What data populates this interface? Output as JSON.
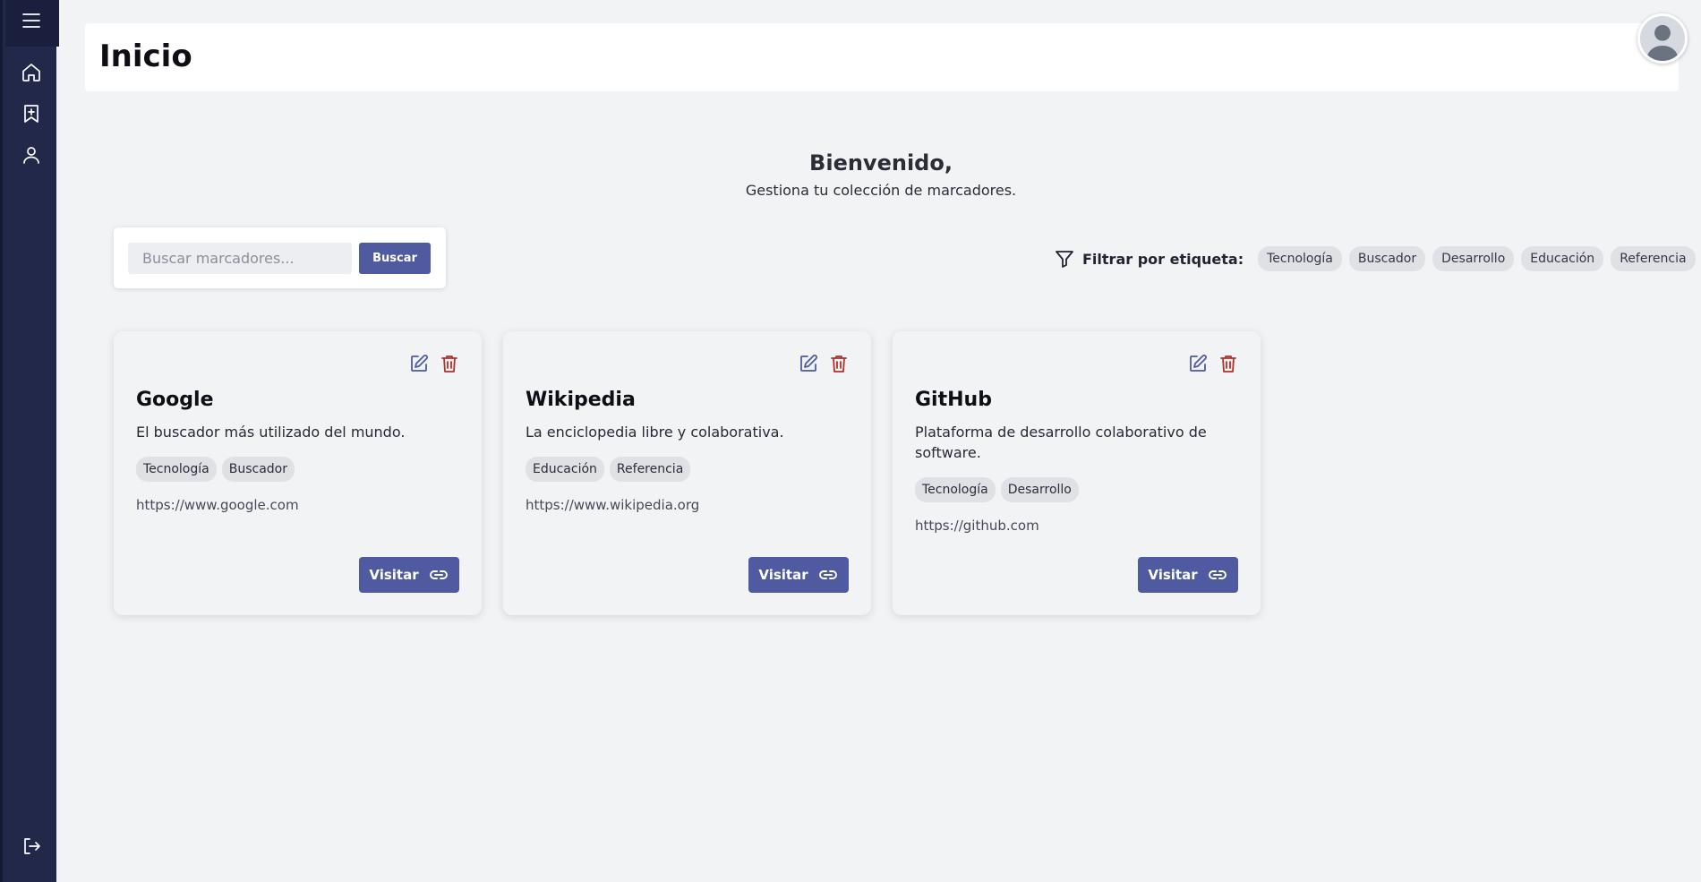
{
  "sidebar": {
    "items": [
      {
        "icon": "menu-icon"
      },
      {
        "icon": "home-icon"
      },
      {
        "icon": "bookmark-add-icon"
      },
      {
        "icon": "user-icon"
      },
      {
        "icon": "logout-icon"
      }
    ]
  },
  "header": {
    "title": "Inicio"
  },
  "welcome": {
    "title": "Bienvenido,",
    "subtitle": "Gestiona tu colección de marcadores."
  },
  "search": {
    "placeholder": "Buscar marcadores...",
    "button_label": "Buscar"
  },
  "filter": {
    "label": "Filtrar por etiqueta:",
    "tags": [
      "Tecnología",
      "Buscador",
      "Desarrollo",
      "Educación",
      "Referencia"
    ]
  },
  "bookmarks": [
    {
      "title": "Google",
      "description": "El buscador más utilizado del mundo.",
      "tags": [
        "Tecnología",
        "Buscador"
      ],
      "url": "https://www.google.com",
      "visit_label": "Visitar"
    },
    {
      "title": "Wikipedia",
      "description": "La enciclopedia libre y colaborativa.",
      "tags": [
        "Educación",
        "Referencia"
      ],
      "url": "https://www.wikipedia.org",
      "visit_label": "Visitar"
    },
    {
      "title": "GitHub",
      "description": "Plataforma de desarrollo colaborativo de software.",
      "tags": [
        "Tecnología",
        "Desarrollo"
      ],
      "url": "https://github.com",
      "visit_label": "Visitar"
    }
  ],
  "colors": {
    "sidebar": "#22284a",
    "accent": "#4f5aa0",
    "delete": "#b0302c",
    "background": "#f2f3f5"
  }
}
